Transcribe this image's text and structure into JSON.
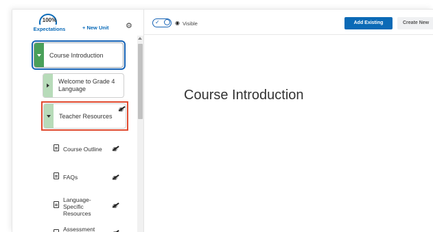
{
  "sidebar": {
    "expectations": {
      "value": "100%",
      "label": "Expectations"
    },
    "new_unit_label": "+ New Unit",
    "tree": {
      "course_intro": "Course Introduction",
      "welcome": "Welcome to Grade 4 Language",
      "teacher_resources": "Teacher Resources",
      "items": [
        {
          "label": "Course Outline"
        },
        {
          "label": "FAQs"
        },
        {
          "label": "Language-Specific Resources"
        },
        {
          "label": "Assessment"
        }
      ]
    }
  },
  "toolbar": {
    "visibility_label": "Visible",
    "add_existing_label": "Add Existing",
    "create_new_label": "Create New"
  },
  "main": {
    "title": "Course Introduction"
  },
  "colors": {
    "accent": "#0b6ab6",
    "module_green": "#4aa05a",
    "submodule_green": "#b7dbb9",
    "highlight_red": "#e0492e"
  }
}
